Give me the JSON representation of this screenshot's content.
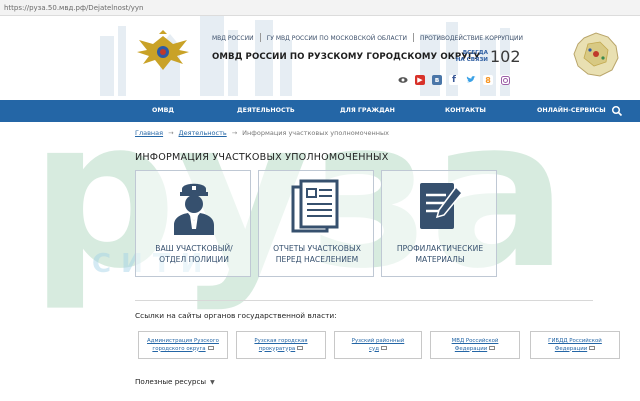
{
  "browser": {
    "url": "https://руза.50.мвд.рф/Dejatelnost/yyn"
  },
  "header": {
    "top_links": [
      "МВД РОССИИ",
      "ГУ МВД РОССИИ ПО МОСКОВСКОЙ ОБЛАСТИ",
      "ПРОТИВОДЕЙСТВИЕ КОРРУПЦИИ"
    ],
    "title": "ОМВД РОССИИ ПО РУЗСКОМУ ГОРОДСКОМУ ОКРУГУ",
    "always_line1": "ВСЕГДА",
    "always_line2": "НА СВЯЗИ",
    "phone": "102",
    "socials": [
      "eye-icon",
      "youtube-icon",
      "vk-icon",
      "facebook-icon",
      "twitter-icon",
      "odnoklassniki-icon",
      "instagram-icon"
    ]
  },
  "nav": {
    "items": [
      "ОМВД",
      "ДЕЯТЕЛЬНОСТЬ",
      "ДЛЯ ГРАЖДАН",
      "КОНТАКТЫ",
      "ОНЛАЙН-СЕРВИСЫ"
    ]
  },
  "breadcrumb": [
    "Главная",
    "Деятельность",
    "Информация участковых уполномоченных"
  ],
  "page_title": "ИНФОРМАЦИЯ УЧАСТКОВЫХ УПОЛНОМОЧЕННЫХ",
  "cards": [
    {
      "line1": "ВАШ УЧАСТКОВЫЙ/",
      "line2": "ОТДЕЛ ПОЛИЦИИ",
      "icon": "officer-icon"
    },
    {
      "line1": "ОТЧЕТЫ УЧАСТКОВЫХ",
      "line2": "ПЕРЕД НАСЕЛЕНИЕМ",
      "icon": "documents-icon"
    },
    {
      "line1": "ПРОФИЛАКТИЧЕСКИЕ",
      "line2": "МАТЕРИАЛЫ",
      "icon": "edit-document-icon"
    }
  ],
  "links_heading": "Ссылки на сайты органов государственной власти:",
  "org_links": [
    {
      "line1": "Администрация Рузского",
      "line2": "городского округа"
    },
    {
      "line1": "Рузская городская",
      "line2": "прокуратура"
    },
    {
      "line1": "Рузский районный",
      "line2": "суд"
    },
    {
      "line1": "МВД Российской",
      "line2": "Федерации"
    },
    {
      "line1": "ГИБДД Российской",
      "line2": "Федерации"
    }
  ],
  "useful_resources": "Полезные ресурсы",
  "watermark_text": "руза",
  "watermark_sub": "СИТИ",
  "colors": {
    "nav_bg": "#2466a6",
    "card_text": "#36506e",
    "link": "#2466a6",
    "watermark": "#7fbf9a"
  }
}
